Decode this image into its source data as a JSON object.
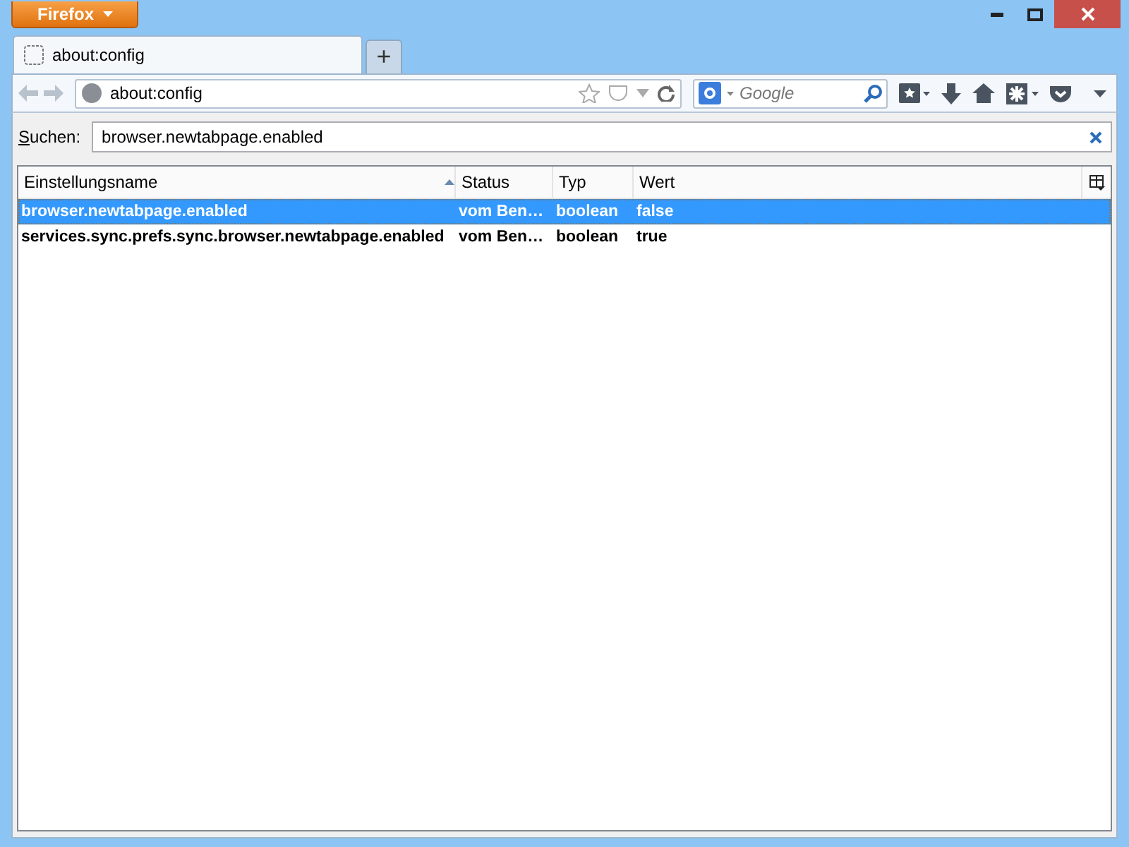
{
  "window": {
    "app_button": "Firefox"
  },
  "tabs": [
    {
      "label": "about:config",
      "selected": true
    }
  ],
  "new_tab": "+",
  "url_bar": {
    "value": "about:config"
  },
  "search_bar": {
    "placeholder": "Google"
  },
  "config": {
    "search_label": "Suchen:",
    "search_value": "browser.newtabpage.enabled",
    "columns": [
      {
        "label": "Einstellungsname",
        "sorted": true
      },
      {
        "label": "Status",
        "sorted": false
      },
      {
        "label": "Typ",
        "sorted": false
      },
      {
        "label": "Wert",
        "sorted": false
      }
    ],
    "rows": [
      {
        "name": "browser.newtabpage.enabled",
        "status": "vom Ben…",
        "type": "boolean",
        "value": "false",
        "selected": true
      },
      {
        "name": "services.sync.prefs.sync.browser.newtabpage.enabled",
        "status": "vom Ben…",
        "type": "boolean",
        "value": "true",
        "selected": false
      }
    ]
  }
}
